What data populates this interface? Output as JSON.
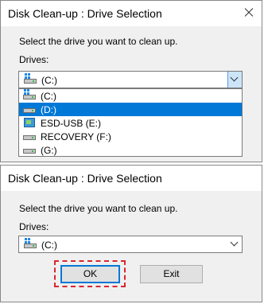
{
  "dialog": {
    "title": "Disk Clean-up : Drive Selection",
    "instruction": "Select the drive you want to clean up.",
    "drives_label": "Drives:"
  },
  "dialog_top": {
    "selected_drive": "(C:)",
    "dropdown_options": [
      {
        "label": "(C:)",
        "icon": "windows-drive-icon",
        "selected": false
      },
      {
        "label": "(D:)",
        "icon": "hard-drive-icon",
        "selected": true
      },
      {
        "label": "ESD-USB (E:)",
        "icon": "usb-drive-icon",
        "selected": false
      },
      {
        "label": "RECOVERY (F:)",
        "icon": "hard-drive-icon",
        "selected": false
      },
      {
        "label": "(G:)",
        "icon": "hard-drive-icon",
        "selected": false
      }
    ]
  },
  "dialog_bottom": {
    "selected_drive": "(C:)",
    "ok_label": "OK",
    "exit_label": "Exit"
  },
  "colors": {
    "selection": "#0078d7",
    "highlight_dash": "#d9272e",
    "dialog_bg": "#f0f0f0"
  }
}
